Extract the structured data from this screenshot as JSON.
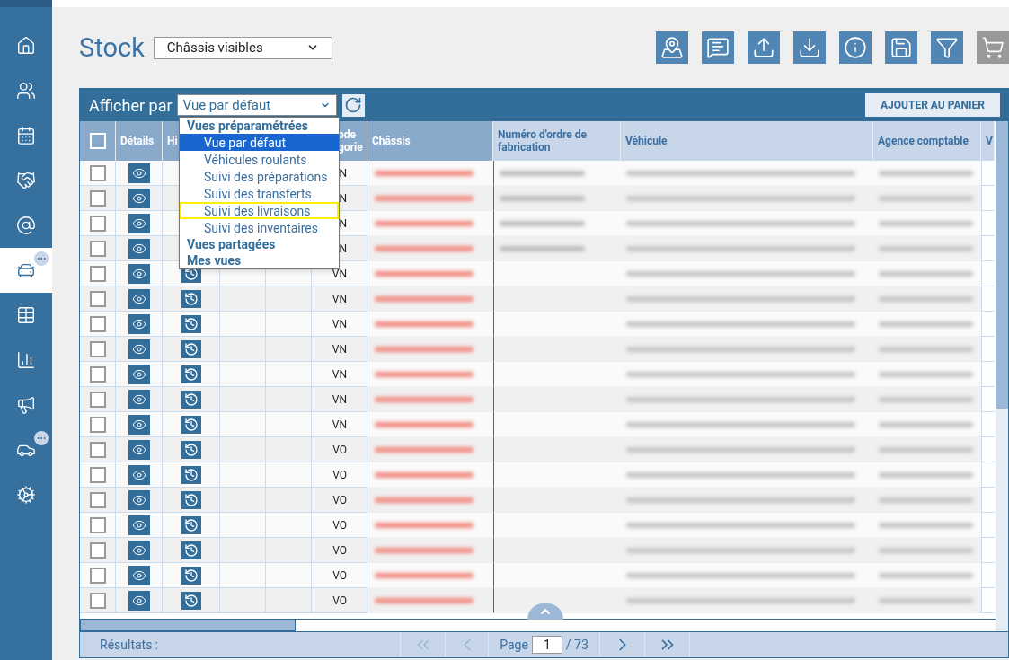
{
  "sidebar": {
    "items": [
      {
        "selected": false,
        "badge": false
      },
      {
        "selected": false,
        "badge": false
      },
      {
        "selected": false,
        "badge": false
      },
      {
        "selected": false,
        "badge": false
      },
      {
        "selected": false,
        "badge": false
      },
      {
        "selected": true,
        "badge": true
      },
      {
        "selected": false,
        "badge": false
      },
      {
        "selected": false,
        "badge": false
      },
      {
        "selected": false,
        "badge": false
      },
      {
        "selected": false,
        "badge": true
      },
      {
        "selected": false,
        "badge": false
      }
    ]
  },
  "header": {
    "title": "Stock",
    "view_select": {
      "value": "Châssis visibles"
    },
    "actions": [
      {
        "disabled": false
      },
      {
        "disabled": false
      },
      {
        "disabled": false
      },
      {
        "disabled": false
      },
      {
        "disabled": false
      },
      {
        "disabled": false
      },
      {
        "disabled": false
      },
      {
        "disabled": true
      }
    ]
  },
  "toolbar": {
    "label": "Afficher par",
    "select": {
      "value": "Vue par défaut"
    },
    "add_button": "AJOUTER AU PANIER"
  },
  "dropdown": {
    "items": [
      {
        "kind": "group",
        "label": "Vues préparamétrées"
      },
      {
        "kind": "option",
        "label": "Vue par défaut",
        "selected": true,
        "highlighted": false
      },
      {
        "kind": "option",
        "label": "Véhicules roulants",
        "selected": false,
        "highlighted": false
      },
      {
        "kind": "option",
        "label": "Suivi des préparations",
        "selected": false,
        "highlighted": false
      },
      {
        "kind": "option",
        "label": "Suivi des transferts",
        "selected": false,
        "highlighted": false
      },
      {
        "kind": "option",
        "label": "Suivi des livraisons",
        "selected": false,
        "highlighted": true
      },
      {
        "kind": "option",
        "label": "Suivi des inventaires",
        "selected": false,
        "highlighted": false
      },
      {
        "kind": "group",
        "label": "Vues partagées"
      },
      {
        "kind": "group",
        "label": "Mes vues"
      }
    ]
  },
  "table": {
    "columns": [
      {
        "kind": "checkbox",
        "pinned": true
      },
      {
        "kind": "text",
        "label": "Détails",
        "pinned": true
      },
      {
        "kind": "text",
        "label": "Hi",
        "pinned": true
      },
      {
        "kind": "text",
        "label": "ode\ngorie",
        "pinned": true
      },
      {
        "kind": "text",
        "label": "Châssis",
        "pinned": true
      },
      {
        "kind": "text",
        "label": "Numéro d'ordre de fabrication",
        "pinned": false
      },
      {
        "kind": "text",
        "label": "Véhicule",
        "pinned": false
      },
      {
        "kind": "text",
        "label": "Agence comptable",
        "pinned": false
      },
      {
        "kind": "text",
        "label": "V",
        "pinned": false
      }
    ],
    "rows": [
      {
        "checked": false,
        "history": false,
        "category": "N",
        "order_number": true
      },
      {
        "checked": false,
        "history": false,
        "category": "N",
        "order_number": true
      },
      {
        "checked": false,
        "history": false,
        "category": "N",
        "order_number": true
      },
      {
        "checked": false,
        "history": false,
        "category": "N",
        "order_number": true
      },
      {
        "checked": false,
        "history": true,
        "category": "VN",
        "order_number": false
      },
      {
        "checked": false,
        "history": true,
        "category": "VN",
        "order_number": false
      },
      {
        "checked": false,
        "history": true,
        "category": "VN",
        "order_number": false
      },
      {
        "checked": false,
        "history": true,
        "category": "VN",
        "order_number": false
      },
      {
        "checked": false,
        "history": true,
        "category": "VN",
        "order_number": false
      },
      {
        "checked": false,
        "history": true,
        "category": "VN",
        "order_number": false
      },
      {
        "checked": false,
        "history": true,
        "category": "VN",
        "order_number": false
      },
      {
        "checked": false,
        "history": true,
        "category": "VO",
        "order_number": false
      },
      {
        "checked": false,
        "history": true,
        "category": "VO",
        "order_number": false
      },
      {
        "checked": false,
        "history": true,
        "category": "VO",
        "order_number": false
      },
      {
        "checked": false,
        "history": true,
        "category": "VO",
        "order_number": false
      },
      {
        "checked": false,
        "history": true,
        "category": "VO",
        "order_number": false
      },
      {
        "checked": false,
        "history": true,
        "category": "VO",
        "order_number": false
      },
      {
        "checked": false,
        "history": true,
        "category": "VO",
        "order_number": false
      }
    ]
  },
  "footer": {
    "results_label": "Résultats :",
    "page_label": "Page",
    "page": "1",
    "total": "/ 73"
  }
}
